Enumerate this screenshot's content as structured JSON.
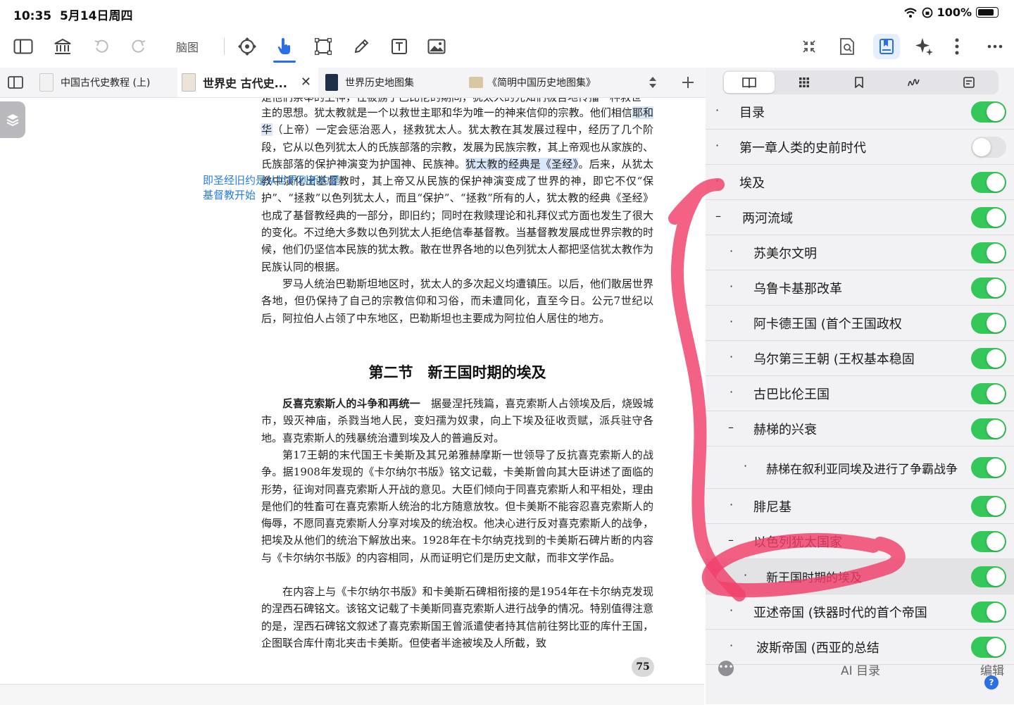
{
  "status": {
    "time": "10:35",
    "date": "5月14日周四",
    "battery": "100%"
  },
  "toolbar": {
    "mindmap_label": "脑图"
  },
  "tabs": [
    {
      "label": "中国古代史教程 (上)"
    },
    {
      "label": "世界史 古代史..."
    },
    {
      "label": "世界历史地图集"
    },
    {
      "label": "《简明中国历史地图集》"
    }
  ],
  "toc": {
    "items": [
      {
        "mark": "·",
        "label": "目录",
        "on": true
      },
      {
        "mark": "·",
        "label": "第一章人类的史前时代",
        "on": false
      },
      {
        "mark": "·",
        "label": "埃及",
        "on": true
      },
      {
        "mark": "–",
        "label": "两河流域",
        "on": true
      },
      {
        "mark": "·",
        "label": "苏美尔文明",
        "on": true
      },
      {
        "mark": "·",
        "label": "乌鲁卡基那改革",
        "on": true
      },
      {
        "mark": "·",
        "label": "阿卡德王国 (首个王国政权",
        "on": true
      },
      {
        "mark": "·",
        "label": "乌尔第三王朝 (王权基本稳固",
        "on": true
      },
      {
        "mark": "·",
        "label": "古巴比伦王国",
        "on": true
      },
      {
        "mark": "–",
        "label": "赫梯的兴衰",
        "on": true
      },
      {
        "mark": "·",
        "label": "赫梯在叙利亚同埃及进行了争霸战争",
        "on": true
      },
      {
        "mark": "·",
        "label": "腓尼基",
        "on": true
      },
      {
        "mark": "–",
        "label": "以色列犹太国家",
        "on": true
      },
      {
        "mark": "·",
        "label": "新王国时期的埃及",
        "on": true
      },
      {
        "mark": "·",
        "label": "亚述帝国 (铁器时代的首个帝国",
        "on": true
      },
      {
        "mark": "·",
        "label": "波斯帝国 (西亚的总结",
        "on": true
      }
    ],
    "footer": {
      "ai_label": "AI 目录",
      "edit_label": "编辑",
      "help": "?"
    }
  },
  "page": {
    "top_partial": "是他们崇奉的上神，往被掳于巴比伦的期间，犹太人的先知们极告地传播一种救世",
    "p1a": "主的思想。犹太教就是一个以救世主耶和华为唯一的神来信仰的宗教。他们相信",
    "p1b": "耶和华",
    "p1c": "（上帝）一定会惩治恶人，拯救犹太人。犹太教在其发展过程中，经历了几个阶段，它从以色列犹太人的氏族部落的宗教，发展为民族宗教，其上帝观也从家族的、氏族部落的保护神演变为护国神、民族神。",
    "p1d": "犹太教的经典是《圣经》",
    "p1e": "。后来，从犹太教中演化出基督教时，其上帝又从民族的保护神演变成了世界的神，即它不仅“保护”、“拯救”以色列犹太人，而且“保护”、“拯救”所有的人，犹太教的经典《圣经》也成了基督教经典的一部分，即旧约；同时在救赎理论和礼拜仪式方面也发生了很大的变化。不过绝大多数以色列犹太人拒绝信奉基督教。当基督教发展成世界宗教的时候，他们仍坚信本民族的犹太教。散在世界各地的以色列犹太人都把坚信犹太教作为民族认同的根据。",
    "p2": "罗马人统治巴勒斯坦地区时，犹太人的多次起义均遭镇压。以后，他们散居世界各地，但仍保持了自己的宗教信仰和习俗，而未遭同化，直至今日。公元7世纪以后，阿拉伯人占领了中东地区，巴勒斯坦也主要成为阿拉伯人居住的地方。",
    "section_title": "第二节　新王国时期的埃及",
    "p3_term": "反喜克索斯人的斗争和再统一",
    "p3": "　据曼涅托残篇，喜克索斯人占领埃及后，烧毁城市，毁灭神庙，杀戮当地人民，变妇孺为奴隶，向上下埃及征收贡赋，派兵驻守各地。喜克索斯人的残暴统治遭到埃及人的普遍反对。",
    "p4": "第17王朝的末代国王卡美斯及其兄弟雅赫摩斯一世领导了反抗喜克索斯人的战争。据1908年发现的《卡尔纳尔书版》铭文记载，卡美斯曾向其大臣讲述了面临的形势，征询对同喜克索斯人开战的意见。大臣们倾向于同喜克索斯人和平相处，理由是他们的牲畜可在喜克索斯人统治的北方随意放牧。但卡美斯不能容忍喜克索斯人的侮辱，不愿同喜克索斯人分享对埃及的统治权。他决心进行反对喜克索斯人的战争，把埃及从他们的统治下解放出来。1928年在卡尔纳克找到的卡美斯石碑片断的内容与《卡尔纳尔书版》的内容相同，从而证明它们是历史文献，而非文学作品。",
    "p5": "在内容上与《卡尔纳尔书版》和卡美斯石碑相衔接的是1954年在卡尔纳克发现的涅西石碑铭文。该铭文记载了卡美斯同喜克索斯人进行战争的情况。特别值得注意的是，涅西石碑铭文叙述了喜克索斯国王曾派遣使者持其信前往努比亚的库什王国，企图联合库什南北夹击卡美斯。但使者半途被埃及人所截，致",
    "margin_note": "即圣经旧约是从世界到新约是基督教开始",
    "page_number": "75"
  },
  "colors": {
    "accent": "#2a6fe6",
    "toggle_on": "#34c759",
    "ink": "#f0406a",
    "note": "#2a7de1"
  }
}
